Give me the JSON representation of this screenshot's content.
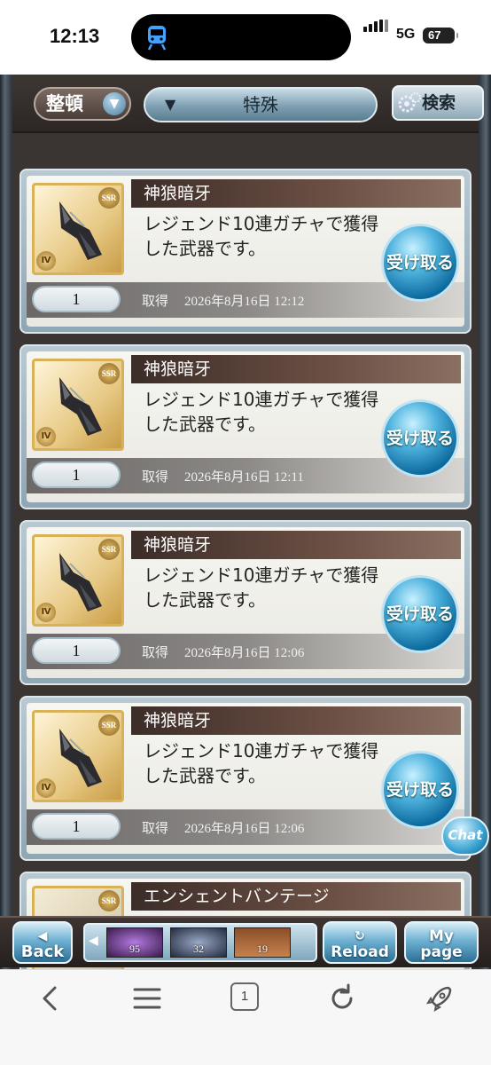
{
  "status_bar": {
    "time": "12:13",
    "network": "5G",
    "battery": "67"
  },
  "toolbar_top": {
    "sort_label": "整頓",
    "filter_label": "特殊",
    "search_label": "検索"
  },
  "gifts": [
    {
      "name": "神狼暗牙",
      "description": "レジェンド10連ガチャで獲得した武器です。",
      "quantity": "1",
      "acquired_label": "取得",
      "acquired_time": "2026年8月16日 12:12",
      "receive_label": "受け取る",
      "rarity": "SSR"
    },
    {
      "name": "神狼暗牙",
      "description": "レジェンド10連ガチャで獲得した武器です。",
      "quantity": "1",
      "acquired_label": "取得",
      "acquired_time": "2026年8月16日 12:11",
      "receive_label": "受け取る",
      "rarity": "SSR"
    },
    {
      "name": "神狼暗牙",
      "description": "レジェンド10連ガチャで獲得した武器です。",
      "quantity": "1",
      "acquired_label": "取得",
      "acquired_time": "2026年8月16日 12:06",
      "receive_label": "受け取る",
      "rarity": "SSR"
    },
    {
      "name": "神狼暗牙",
      "description": "レジェンド10連ガチャで獲得した武器です。",
      "quantity": "1",
      "acquired_label": "取得",
      "acquired_time": "2026年8月16日 12:06",
      "receive_label": "受け取る",
      "rarity": "SSR"
    },
    {
      "name": "エンシェントバンテージ",
      "rarity": "SSR"
    }
  ],
  "chat_label": "Chat",
  "game_nav": {
    "back_label": "Back",
    "reload_label": "Reload",
    "mypage_line1": "My",
    "mypage_line2": "page",
    "items": [
      {
        "count": "95"
      },
      {
        "count": "32"
      },
      {
        "count": "19"
      }
    ]
  },
  "browser": {
    "tab_count": "1"
  },
  "colors": {
    "accent_blue": "#4fb3de",
    "title_brown": "#3c2d28",
    "frame_gold": "#d9b257"
  }
}
